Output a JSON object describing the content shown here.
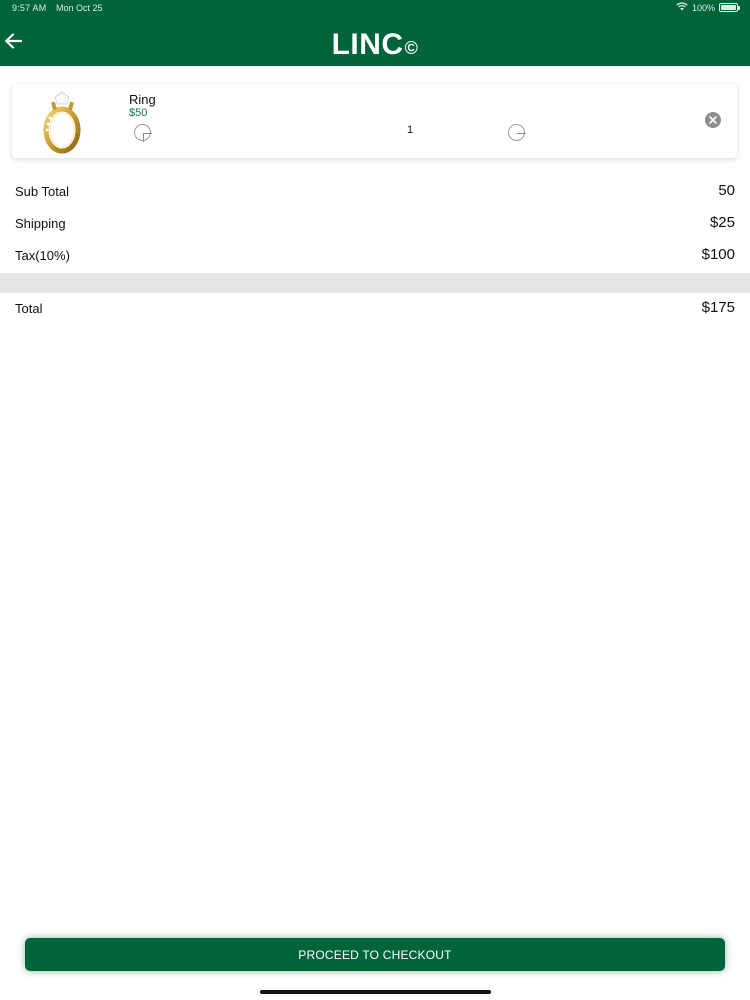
{
  "status_bar": {
    "time": "9:57 AM",
    "date": "Mon Oct 25",
    "battery": "100%"
  },
  "header": {
    "title": "LINC",
    "title_mark": "©",
    "back_icon": "arrow-left-icon",
    "color": "#00643a"
  },
  "cart": {
    "items": [
      {
        "name": "Ring",
        "price": "$50",
        "quantity": "1",
        "image_icon": "gold-ring-image",
        "plus_icon": "plus-circle-icon",
        "minus_icon": "minus-circle-icon",
        "remove_icon": "close-circle-icon"
      }
    ]
  },
  "summary": {
    "subtotal_label": "Sub Total",
    "subtotal_value": "50",
    "shipping_label": "Shipping",
    "shipping_value": "$25",
    "tax_label": "Tax(10%)",
    "tax_value": "$100",
    "total_label": "Total",
    "total_value": "$175"
  },
  "checkout": {
    "label": "PROCEED TO CHECKOUT"
  },
  "colors": {
    "brand": "#00643a",
    "price": "#0a7a45",
    "divider": "#e5e5e7"
  }
}
